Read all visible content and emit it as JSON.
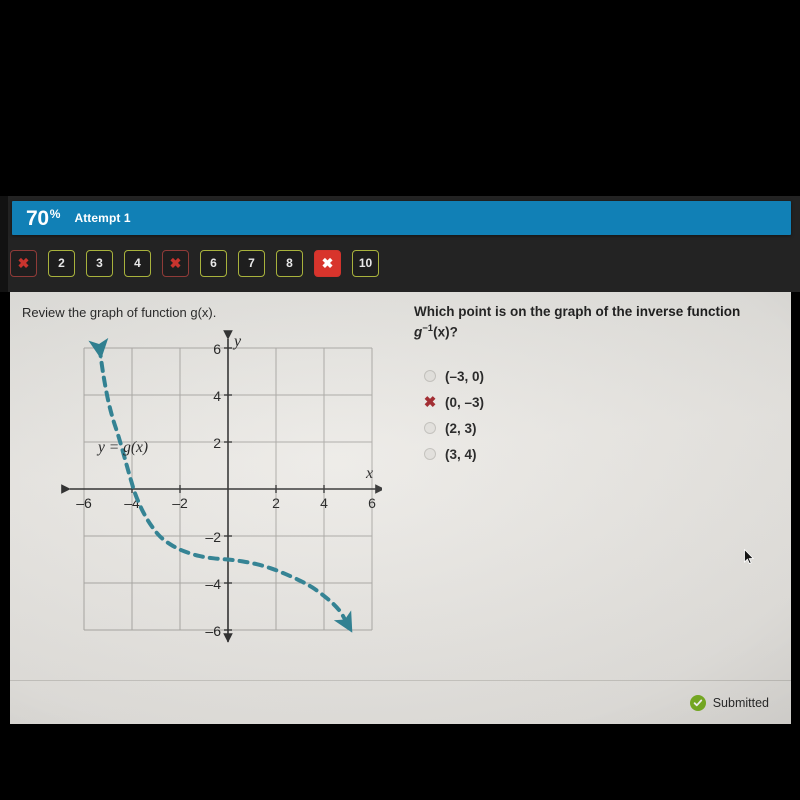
{
  "header": {
    "percent_value": "70",
    "percent_symbol": "%",
    "attempt_label": "Attempt 1"
  },
  "question_nav": {
    "items": [
      {
        "label": "✖",
        "state": "wrong"
      },
      {
        "label": "2",
        "state": "ok"
      },
      {
        "label": "3",
        "state": "ok"
      },
      {
        "label": "4",
        "state": "ok"
      },
      {
        "label": "✖",
        "state": "wrong"
      },
      {
        "label": "6",
        "state": "ok"
      },
      {
        "label": "7",
        "state": "ok"
      },
      {
        "label": "8",
        "state": "ok"
      },
      {
        "label": "✖",
        "state": "current"
      },
      {
        "label": "10",
        "state": "ok"
      }
    ]
  },
  "left_panel": {
    "prompt": "Review the graph of function g(x)."
  },
  "right_panel": {
    "question_part1": "Which point is on the graph of the inverse function ",
    "question_g": "g",
    "question_sup": "−1",
    "question_part2": "(x)?",
    "options": [
      {
        "label": "(–3, 0)",
        "marker": "radio"
      },
      {
        "label": "(0, –3)",
        "marker": "x"
      },
      {
        "label": "(2, 3)",
        "marker": "radio"
      },
      {
        "label": "(3, 4)",
        "marker": "radio"
      }
    ]
  },
  "footer": {
    "status_text": "Submitted"
  },
  "colors": {
    "accent_blue": "#1180b6",
    "curve_teal": "#2a7f91",
    "incorrect_red": "#9e1f24",
    "current_red": "#d8342c",
    "ok_border": "#a8b23c",
    "submitted_green": "#7cb325",
    "card_bg": "#e9e8e4",
    "chrome_dark": "#232323"
  },
  "chart_data": {
    "type": "line",
    "title": "y = g(x)",
    "curve_label": "y = g(x)",
    "xlabel": "x",
    "ylabel": "y",
    "xlim": [
      -6,
      6
    ],
    "ylim": [
      -6,
      6
    ],
    "xticks": [
      -6,
      -4,
      -2,
      2,
      4,
      6
    ],
    "yticks": [
      -6,
      -4,
      -2,
      2,
      4,
      6
    ],
    "xticklabels": [
      "–6",
      "–4",
      "–2",
      "2",
      "4",
      "6"
    ],
    "yticklabels": [
      "–6",
      "–4",
      "–2",
      "2",
      "4",
      "6"
    ],
    "grid": true,
    "grid_step": 2,
    "line_style": "dashed",
    "line_color": "#2a7f91",
    "arrows": [
      "start",
      "end"
    ],
    "notable_points": [
      {
        "x": 0,
        "y": -3,
        "note": "y-intercept of g(x)"
      },
      {
        "x": -4,
        "y": 0,
        "note": "x-intercept of g(x)"
      }
    ],
    "points": [
      {
        "x": -5.35,
        "y": 6.0
      },
      {
        "x": -5.2,
        "y": 4.9
      },
      {
        "x": -5.0,
        "y": 3.8
      },
      {
        "x": -4.8,
        "y": 3.0
      },
      {
        "x": -4.55,
        "y": 2.2
      },
      {
        "x": -4.3,
        "y": 1.3
      },
      {
        "x": -4.05,
        "y": 0.4
      },
      {
        "x": -3.85,
        "y": -0.25
      },
      {
        "x": -3.55,
        "y": -0.95
      },
      {
        "x": -3.2,
        "y": -1.55
      },
      {
        "x": -2.8,
        "y": -2.05
      },
      {
        "x": -2.3,
        "y": -2.42
      },
      {
        "x": -1.8,
        "y": -2.66
      },
      {
        "x": -1.2,
        "y": -2.85
      },
      {
        "x": -0.6,
        "y": -2.95
      },
      {
        "x": 0.0,
        "y": -3.0
      },
      {
        "x": 0.6,
        "y": -3.08
      },
      {
        "x": 1.2,
        "y": -3.2
      },
      {
        "x": 1.8,
        "y": -3.38
      },
      {
        "x": 2.4,
        "y": -3.62
      },
      {
        "x": 3.0,
        "y": -3.9
      },
      {
        "x": 3.5,
        "y": -4.18
      },
      {
        "x": 4.0,
        "y": -4.55
      },
      {
        "x": 4.4,
        "y": -4.9
      },
      {
        "x": 4.7,
        "y": -5.25
      },
      {
        "x": 4.95,
        "y": -5.7
      }
    ]
  }
}
